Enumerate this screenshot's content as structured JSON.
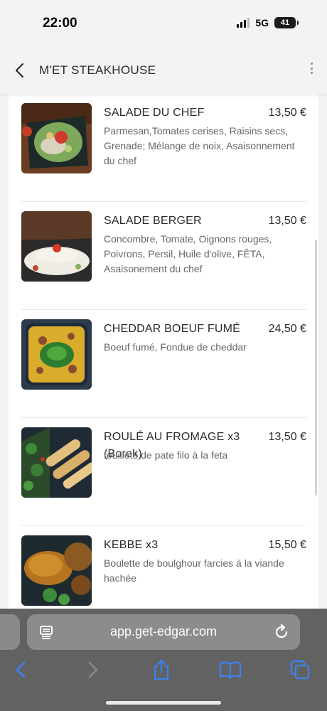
{
  "status_bar": {
    "time": "22:00",
    "network": "5G",
    "battery": "41"
  },
  "header": {
    "title": "M'ET STEAKHOUSE"
  },
  "menu": [
    {
      "name": "SALADE DU CHEF",
      "price": "13,50 €",
      "description": "Parmesan,Tomates cerises, Raisins secs, Grenade; Mélange de noix, Asaisonnement du chef",
      "image": "chef-salad-image"
    },
    {
      "name": "SALADE BERGER",
      "price": "13,50 €",
      "description": "Concombre, Tomate, Oignons rouges, Poivrons, Persil, Huile d'olive, FÊTA, Asaisonement du chef",
      "image": "shepherd-salad-image"
    },
    {
      "name": "CHEDDAR BOEUF FUMÉ",
      "price": "24,50 €",
      "description": "Boeuf fumé, Fondue de cheddar",
      "image": "cheddar-beef-image"
    },
    {
      "name": "ROULÉ AU FROMAGE x3 (Borek)",
      "price": "13,50 €",
      "description": "feuilleté de pate filo à la feta",
      "image": "cheese-roll-image"
    },
    {
      "name": "KEBBE x3",
      "price": "15,50 €",
      "description": "Boulette de boulghour farcies à la viande hachée",
      "image": "kebbe-image"
    }
  ],
  "browser": {
    "url": "app.get-edgar.com"
  },
  "colors": {
    "accent": "#3b82f6",
    "browser_chrome": "#626262",
    "card": "#ffffff"
  }
}
